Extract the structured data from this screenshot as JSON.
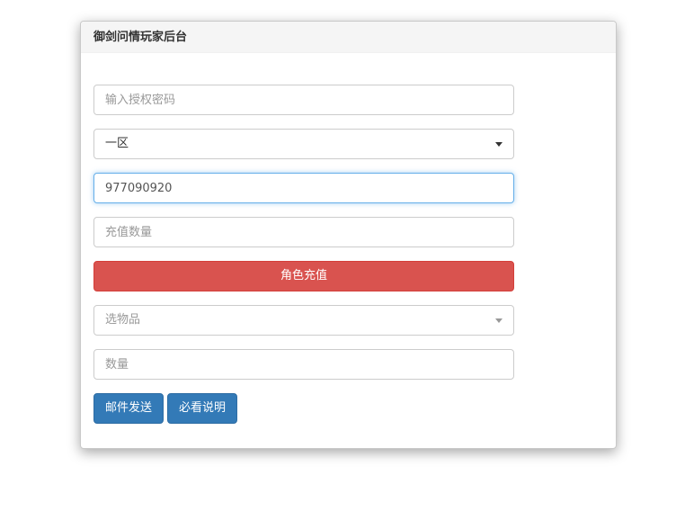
{
  "panel": {
    "title": "御剑问情玩家后台"
  },
  "form": {
    "auth_code": {
      "placeholder": "输入授权密码",
      "value": ""
    },
    "server_select": {
      "selected": "一区"
    },
    "player_id": {
      "value": "977090920",
      "placeholder": ""
    },
    "recharge_amount": {
      "placeholder": "充值数量",
      "value": ""
    },
    "recharge_button": "角色充值",
    "item_select": {
      "placeholder": "选物品"
    },
    "item_quantity": {
      "placeholder": "数量",
      "value": ""
    },
    "mail_button": "邮件发送",
    "help_button": "必看说明"
  },
  "colors": {
    "danger": "#d9534f",
    "primary": "#337ab7",
    "focus": "#66afe9"
  },
  "icons": {
    "dropdown": "caret-down-icon"
  }
}
